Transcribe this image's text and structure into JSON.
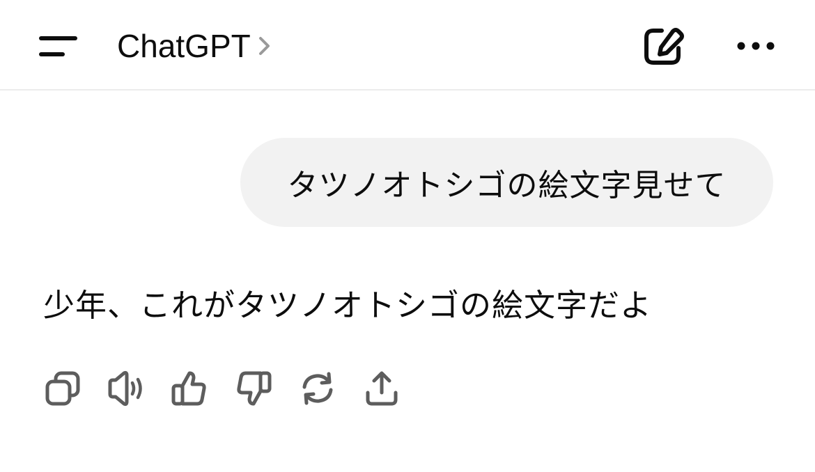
{
  "header": {
    "title": "ChatGPT",
    "icons": {
      "menu": "menu-icon",
      "title_chevron": "chevron-right-icon",
      "compose": "new-chat-icon",
      "more": "more-icon"
    }
  },
  "conversation": {
    "user_message": "タツノオトシゴの絵文字見せて",
    "assistant_message": "少年、これがタツノオトシゴの絵文字だよ"
  },
  "actions": [
    {
      "name": "copy",
      "icon": "copy-icon"
    },
    {
      "name": "read-aloud",
      "icon": "speaker-icon"
    },
    {
      "name": "good-response",
      "icon": "thumbs-up-icon"
    },
    {
      "name": "bad-response",
      "icon": "thumbs-down-icon"
    },
    {
      "name": "regenerate",
      "icon": "refresh-icon"
    },
    {
      "name": "share",
      "icon": "share-icon"
    }
  ],
  "colors": {
    "text": "#0d0d0d",
    "icon": "#5d5d5d",
    "bubble": "#f2f2f2",
    "divider": "#ececec",
    "chevron": "#9a9a9a"
  }
}
